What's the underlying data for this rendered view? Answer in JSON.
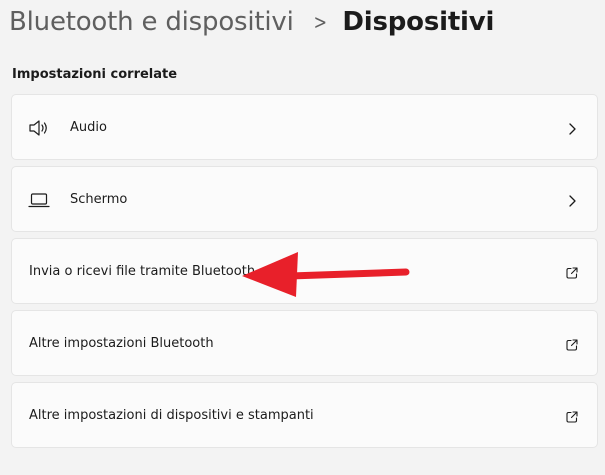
{
  "breadcrumb": {
    "parent": "Bluetooth e dispositivi",
    "separator": ">",
    "current": "Dispositivi"
  },
  "related_settings": {
    "title": "Impostazioni correlate",
    "items": [
      {
        "label": "Audio",
        "icon": "speaker-icon",
        "action": "chevron-right-icon"
      },
      {
        "label": "Schermo",
        "icon": "laptop-icon",
        "action": "chevron-right-icon"
      },
      {
        "label": "Invia o ricevi file tramite Bluetooth",
        "action": "external-link-icon"
      },
      {
        "label": "Altre impostazioni Bluetooth",
        "action": "external-link-icon"
      },
      {
        "label": "Altre impostazioni di dispositivi e stampanti",
        "action": "external-link-icon"
      }
    ]
  },
  "annotation": {
    "arrow_color": "#e8202a",
    "points_to": "Invia o ricevi file tramite Bluetooth"
  },
  "colors": {
    "background": "#f3f3f3",
    "card": "#fbfbfb",
    "card_border": "#e5e5e5"
  }
}
